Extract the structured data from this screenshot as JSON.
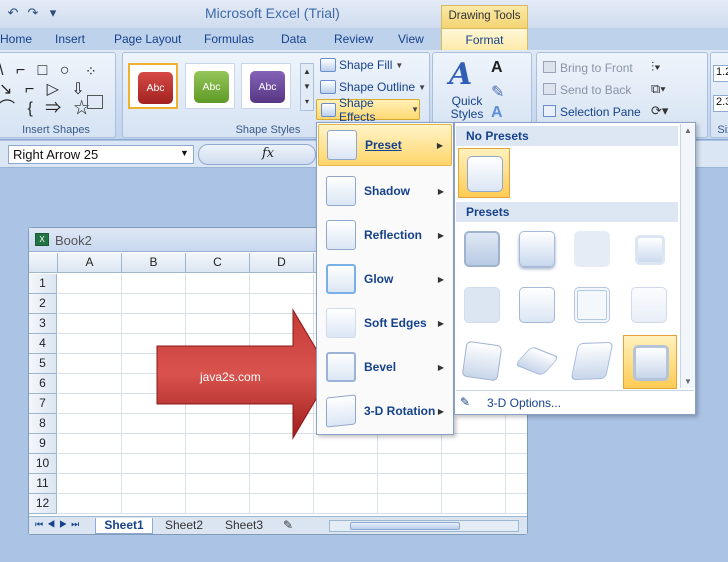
{
  "app": {
    "title": "Microsoft Excel (Trial)"
  },
  "qat": {
    "undo": "↶",
    "redo": "↷",
    "more": "▾"
  },
  "contextual": {
    "header": "Drawing Tools",
    "tab": "Format"
  },
  "tabs": [
    "Home",
    "Insert",
    "Page Layout",
    "Formulas",
    "Data",
    "Review",
    "View"
  ],
  "ribbon": {
    "insert_shapes": {
      "label": "Insert Shapes",
      "glyphs": "\\ ⌐ □ ○\n↘ ⌐ ▷ ⇩\n⌒ { ⇒ ☆"
    },
    "shape_styles": {
      "label": "Shape Styles",
      "thumbs": [
        {
          "text": "Abc",
          "color": "#c0302f"
        },
        {
          "text": "Abc",
          "color": "#7ab23d"
        },
        {
          "text": "Abc",
          "color": "#6a4a9b"
        }
      ]
    },
    "shape_fill": "Shape Fill",
    "shape_outline": "Shape Outline",
    "shape_effects": "Shape Effects",
    "quick_styles": "Quick Styles",
    "arrange": {
      "bring_front": "Bring to Front",
      "send_back": "Send to Back",
      "selection_pane": "Selection Pane"
    },
    "size": {
      "label": "Siz",
      "h": "1.2",
      "w": "2.3"
    }
  },
  "formula": {
    "name_box": "Right Arrow 25",
    "fx": "fx"
  },
  "workbook": {
    "title": "Book2",
    "columns": [
      "A",
      "B",
      "C",
      "D"
    ],
    "rows": [
      "1",
      "2",
      "3",
      "4",
      "5",
      "6",
      "7",
      "8",
      "9",
      "10",
      "11",
      "12"
    ],
    "sheets": [
      "Sheet1",
      "Sheet2",
      "Sheet3"
    ],
    "arrow_text": "java2s.com"
  },
  "effects_menu": {
    "items": [
      {
        "label": "Preset",
        "active": true
      },
      {
        "label": "Shadow"
      },
      {
        "label": "Reflection"
      },
      {
        "label": "Glow"
      },
      {
        "label": "Soft Edges"
      },
      {
        "label": "Bevel"
      },
      {
        "label": "3-D Rotation"
      }
    ]
  },
  "preset_panel": {
    "no_presets": "No Presets",
    "presets": "Presets",
    "options": "3-D Options..."
  },
  "colors": {
    "accent": "#15428b",
    "highlight": "#ffd56a",
    "arrow": "#c0302f"
  }
}
